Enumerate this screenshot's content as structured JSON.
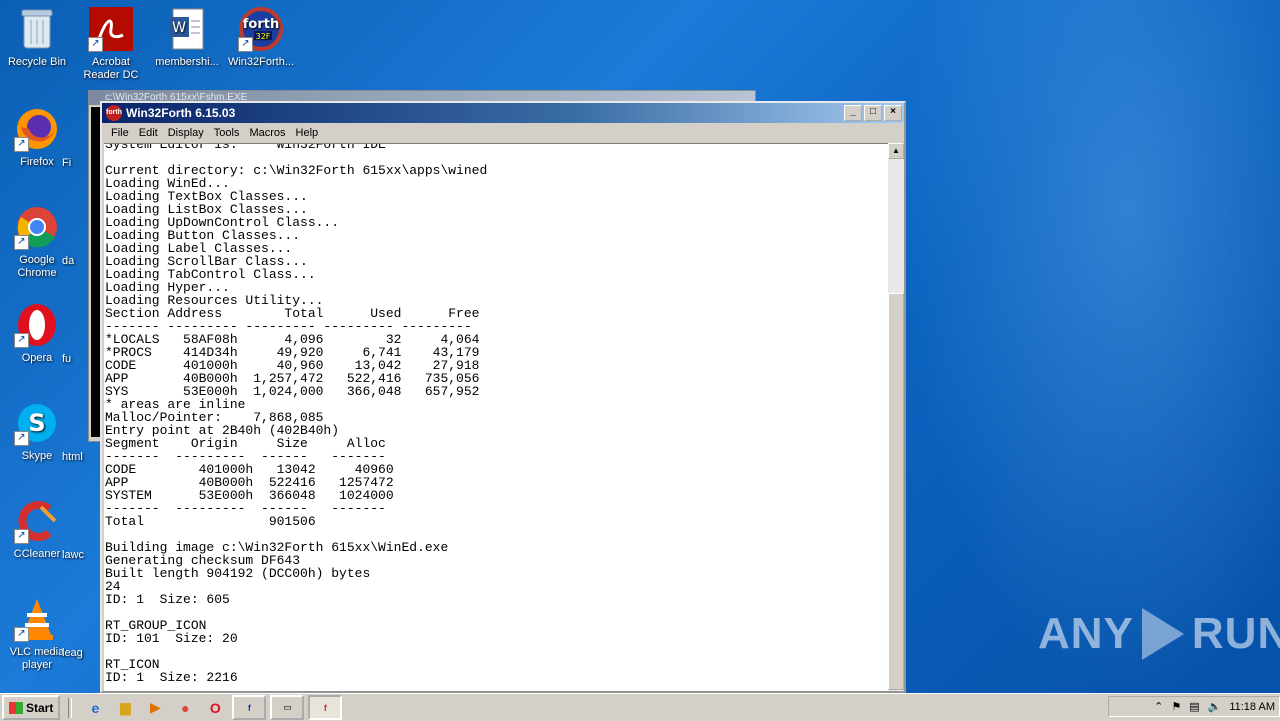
{
  "desktop": {
    "icons": [
      {
        "label": "Recycle Bin",
        "name": "recycle-bin-icon"
      },
      {
        "label": "Acrobat Reader DC",
        "name": "acrobat-reader-icon"
      },
      {
        "label": "membershi...",
        "name": "word-document-icon"
      },
      {
        "label": "Win32Forth...",
        "name": "win32forth-icon"
      },
      {
        "label": "Firefox",
        "name": "firefox-icon"
      },
      {
        "label": "Google Chrome",
        "name": "chrome-icon"
      },
      {
        "label": "Opera",
        "name": "opera-icon"
      },
      {
        "label": "Skype",
        "name": "skype-icon"
      },
      {
        "label": "CCleaner",
        "name": "ccleaner-icon"
      },
      {
        "label": "VLC media player",
        "name": "vlc-icon"
      }
    ],
    "partial_labels": [
      "Fi",
      "da",
      "fu",
      "html",
      "lawc",
      "leag"
    ]
  },
  "back_window": {
    "title": "c:\\Win32Forth 615xx\\Fshm.EXE"
  },
  "window": {
    "title": "Win32Forth 6.15.03",
    "icon_text": "forth",
    "menu": [
      "File",
      "Edit",
      "Display",
      "Tools",
      "Macros",
      "Help"
    ],
    "buttons": {
      "minimize": "_",
      "maximize": "□",
      "close": "×"
    },
    "console_text": "System Editor is:     Win32Forth IDE\n\nCurrent directory: c:\\Win32Forth 615xx\\apps\\wined\nLoading WinEd...\nLoading TextBox Classes...\nLoading ListBox Classes...\nLoading UpDownControl Class...\nLoading Button Classes...\nLoading Label Classes...\nLoading ScrollBar Class...\nLoading TabControl Class...\nLoading Hyper...\nLoading Resources Utility...\nSection Address        Total      Used      Free\n------- --------- --------- --------- ---------\n*LOCALS   58AF08h      4,096        32     4,064\n*PROCS    414D34h     49,920     6,741    43,179\nCODE      401000h     40,960    13,042    27,918\nAPP       40B000h  1,257,472   522,416   735,056\nSYS       53E000h  1,024,000   366,048   657,952\n* areas are inline\nMalloc/Pointer:    7,868,085\nEntry point at 2B40h (402B40h)\nSegment    Origin     Size     Alloc\n-------  ---------  ------   -------\nCODE        401000h   13042     40960\nAPP         40B000h  522416   1257472\nSYSTEM      53E000h  366048   1024000\n-------  ---------  ------   -------\nTotal                901506\n\nBuilding image c:\\Win32Forth 615xx\\WinEd.exe\nGenerating checksum DF643\nBuilt length 904192 (DCC00h) bytes\n24\nID: 1  Size: 605\n\nRT_GROUP_ICON\nID: 101  Size: 20\n\nRT_ICON\nID: 1  Size: 2216"
  },
  "taskbar": {
    "start_label": "Start",
    "clock": "11:18 AM"
  },
  "watermark": {
    "left": "ANY",
    "right": "RUN"
  }
}
